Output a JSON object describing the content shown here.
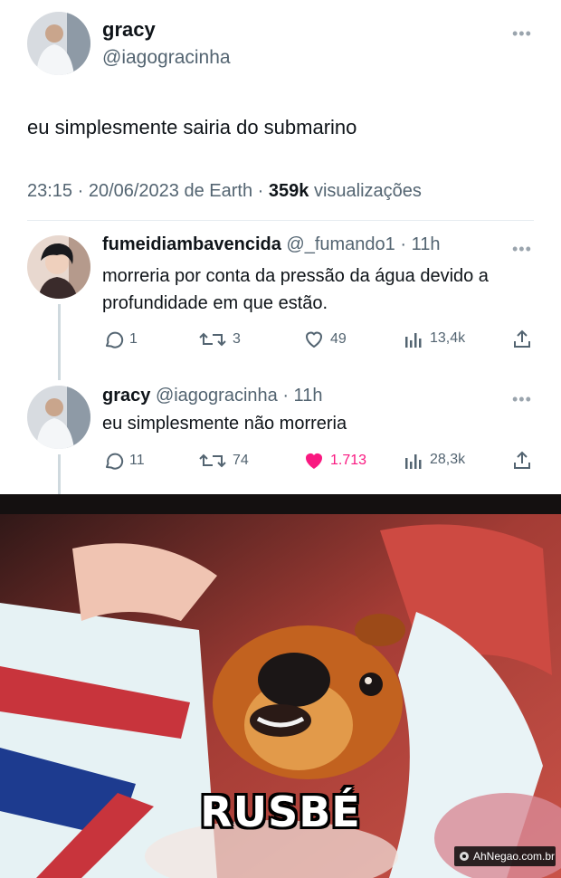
{
  "main_tweet": {
    "name": "gracy",
    "handle": "@iagogracinha",
    "text": "eu simplesmente sairia do submarino",
    "time": "23:15 · 20/06/2023 de Earth ·",
    "views_count": "359k",
    "views_label": "visualizações",
    "more_icon": "more-horizontal-icon"
  },
  "reply1": {
    "name": "fumeidiambavencida",
    "handle": "@_fumando1",
    "time": "· 11h",
    "text": "morreria por conta da pressão da água devido a profundidade em que estão.",
    "replies": "1",
    "retweets": "3",
    "likes": "49",
    "views": "13,4k"
  },
  "reply2": {
    "name": "gracy",
    "handle": "@iagogracinha",
    "time": "· 11h",
    "text": "eu simplesmente não morreria",
    "replies": "11",
    "retweets": "74",
    "likes": "1.713",
    "views": "28,3k",
    "liked": true
  },
  "meme": {
    "caption": "RUSBÉ",
    "watermark": "AhNegao.com.br"
  },
  "colors": {
    "text": "#0f1419",
    "secondary": "#536471",
    "like": "#f91880",
    "thread_line": "#cfd9de"
  }
}
